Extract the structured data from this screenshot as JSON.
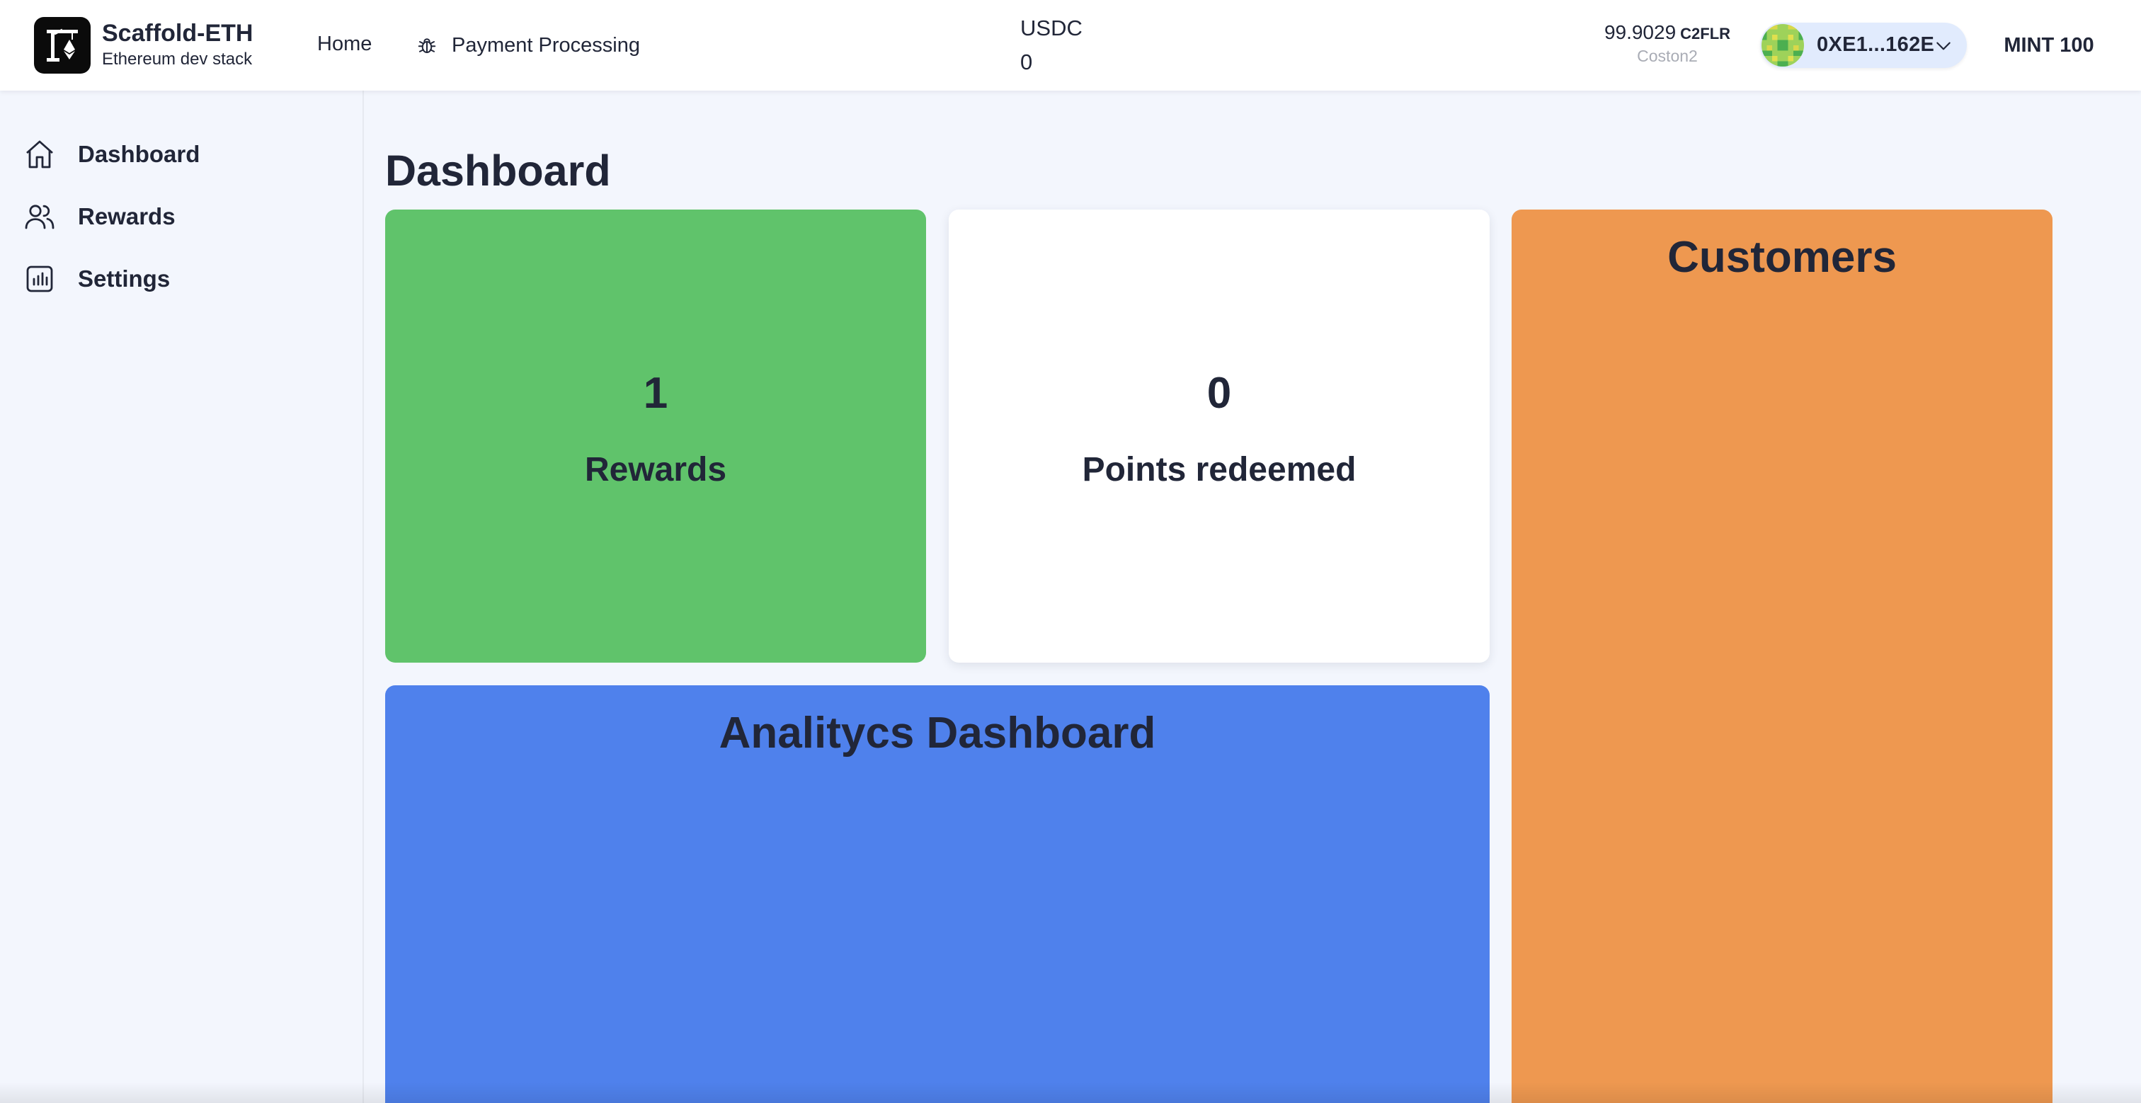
{
  "header": {
    "brand": {
      "name": "Scaffold-ETH",
      "subtitle": "Ethereum dev stack"
    },
    "nav": [
      {
        "label": "Home",
        "icon": null
      },
      {
        "label": "Payment Processing",
        "icon": "bug-icon"
      }
    ],
    "token": {
      "symbol": "USDC",
      "balance": "0"
    },
    "wallet": {
      "balance": "99.9029",
      "unit": "C2FLR",
      "network": "Coston2",
      "address": "0XE1...162E"
    },
    "mint_label": "MINT 100"
  },
  "sidebar": {
    "items": [
      {
        "label": "Dashboard",
        "icon": "home-icon"
      },
      {
        "label": "Rewards",
        "icon": "users-icon"
      },
      {
        "label": "Settings",
        "icon": "chart-bar-icon"
      }
    ]
  },
  "main": {
    "title": "Dashboard",
    "cards": {
      "rewards": {
        "value": "1",
        "label": "Rewards",
        "color": "#60c36b"
      },
      "points": {
        "value": "0",
        "label": "Points redeemed",
        "color": "#ffffff"
      },
      "customers": {
        "title": "Customers",
        "color": "#ee9850"
      },
      "analytics": {
        "title": "Analitycs Dashboard",
        "color": "#4f81ec"
      }
    }
  },
  "colors": {
    "text": "#212638",
    "background": "#f3f6fd",
    "pill": "#e1ebfd",
    "muted": "#a9acb5"
  }
}
